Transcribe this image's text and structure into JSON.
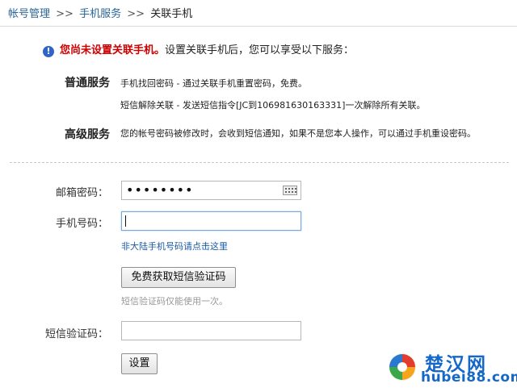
{
  "breadcrumb": {
    "item1": "帐号管理",
    "sep1": ">>",
    "item2": "手机服务",
    "sep2": ">>",
    "current": "关联手机"
  },
  "notice": {
    "icon": "!",
    "warning": "您尚未设置关联手机。",
    "description": "设置关联手机后，您可以享受以下服务："
  },
  "services": {
    "normal": {
      "label": "普通服务",
      "line1": "手机找回密码 - 通过关联手机重置密码，免费。",
      "line2": "短信解除关联 - 发送短信指令[JC到106981630163331]一次解除所有关联。"
    },
    "advanced": {
      "label": "高级服务",
      "line1": "您的帐号密码被修改时，会收到短信通知，如果不是您本人操作，可以通过手机重设密码。"
    }
  },
  "form": {
    "email_password_label": "邮箱密码：",
    "email_password_value": "••••••••",
    "phone_label": "手机号码：",
    "phone_value": "",
    "non_mainland_link": "非大陆手机号码请点击这里",
    "get_code_button": "免费获取短信验证码",
    "code_hint": "短信验证码仅能使用一次。",
    "sms_code_label": "短信验证码：",
    "sms_code_value": "",
    "submit_button": "设置"
  },
  "watermark": {
    "cn": "楚汉网",
    "en": "hubei88.com"
  },
  "colors": {
    "warning_red": "#cc0000",
    "link_blue": "#1b5aa6",
    "watermark_blue": "#1668c8",
    "icon_blue": "#2f64c9"
  }
}
